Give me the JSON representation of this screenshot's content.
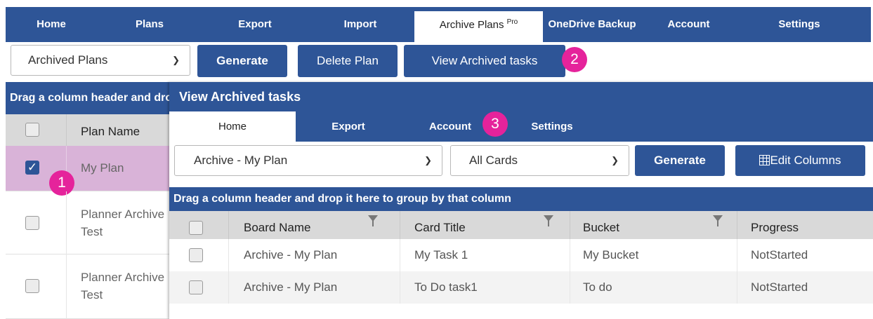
{
  "topnav": {
    "tabs": [
      {
        "label": "Home"
      },
      {
        "label": "Plans"
      },
      {
        "label": "Export"
      },
      {
        "label": "Import"
      },
      {
        "label": "Archive Plans",
        "sup": "Pro"
      },
      {
        "label": "OneDrive Backup"
      },
      {
        "label": "Account"
      },
      {
        "label": "Settings"
      }
    ]
  },
  "toolbar": {
    "plan_select": "Archived Plans",
    "generate": "Generate",
    "delete_plan": "Delete Plan",
    "view_archived": "View Archived tasks"
  },
  "badges": {
    "one": "1",
    "two": "2",
    "three": "3"
  },
  "bg_grid": {
    "group_text": "Drag a column header and drop it here to group by that column",
    "header": "Plan Name",
    "rows": [
      {
        "name": "My Plan",
        "checked": true
      },
      {
        "line1": "Planner Archive",
        "line2": "Test",
        "checked": false
      },
      {
        "line1": "Planner Archive",
        "line2": "Test",
        "checked": false
      }
    ]
  },
  "modal": {
    "title": "View Archived tasks",
    "tabs": [
      {
        "label": "Home"
      },
      {
        "label": "Export"
      },
      {
        "label": "Account"
      },
      {
        "label": "Settings"
      }
    ],
    "board_select": "Archive - My Plan",
    "cards_select": "All Cards",
    "generate": "Generate",
    "edit_columns": "Edit Columns",
    "group_text": "Drag a column header and drop it here to group by that column",
    "columns": [
      "Board Name",
      "Card Title",
      "Bucket",
      "Progress"
    ],
    "rows": [
      {
        "board": "Archive - My Plan",
        "title": "My Task 1",
        "bucket": "My Bucket",
        "progress": "NotStarted"
      },
      {
        "board": "Archive - My Plan",
        "title": "To Do task1",
        "bucket": "To do",
        "progress": "NotStarted"
      }
    ]
  },
  "colors": {
    "brand": "#2e5597",
    "badge": "#e5239b",
    "selected_row": "#d9b3d8"
  }
}
